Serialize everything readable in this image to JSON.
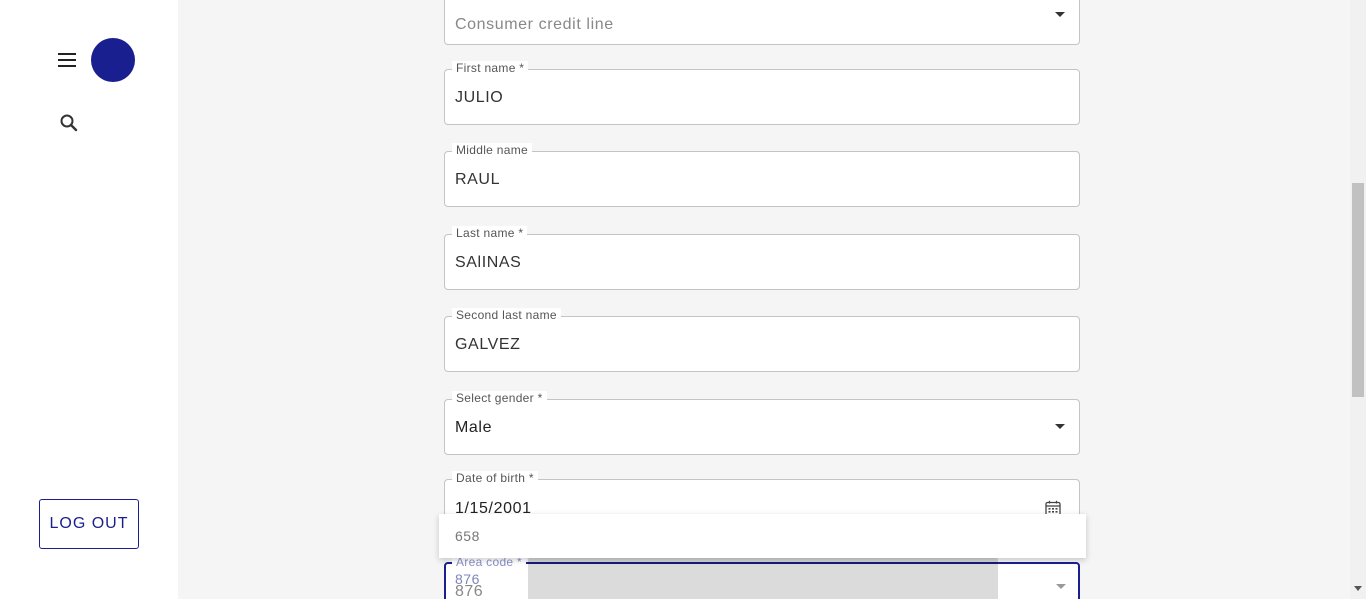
{
  "sidebar": {
    "logout_label": "LOG OUT"
  },
  "form": {
    "credit_line": {
      "value": "Consumer credit line"
    },
    "first_name": {
      "label": "First name *",
      "value": "JULIO"
    },
    "middle_name": {
      "label": "Middle name",
      "value": "RAUL"
    },
    "last_name": {
      "label": "Last name *",
      "value": "SAlINAS"
    },
    "second_last_name": {
      "label": "Second last name",
      "value": "GALVEZ"
    },
    "gender": {
      "label": "Select gender *",
      "value": "Male"
    },
    "dob": {
      "label": "Date of birth *",
      "value": "1/15/2001"
    },
    "area_code": {
      "label": "Area code *",
      "value": "876",
      "display": "876",
      "options": [
        "658"
      ]
    }
  },
  "colors": {
    "accent": "#1a1f8f"
  },
  "icons": {
    "menu": "menu-icon",
    "search": "search-icon",
    "calendar": "calendar-icon",
    "dropdown": "chevron-down-icon"
  }
}
